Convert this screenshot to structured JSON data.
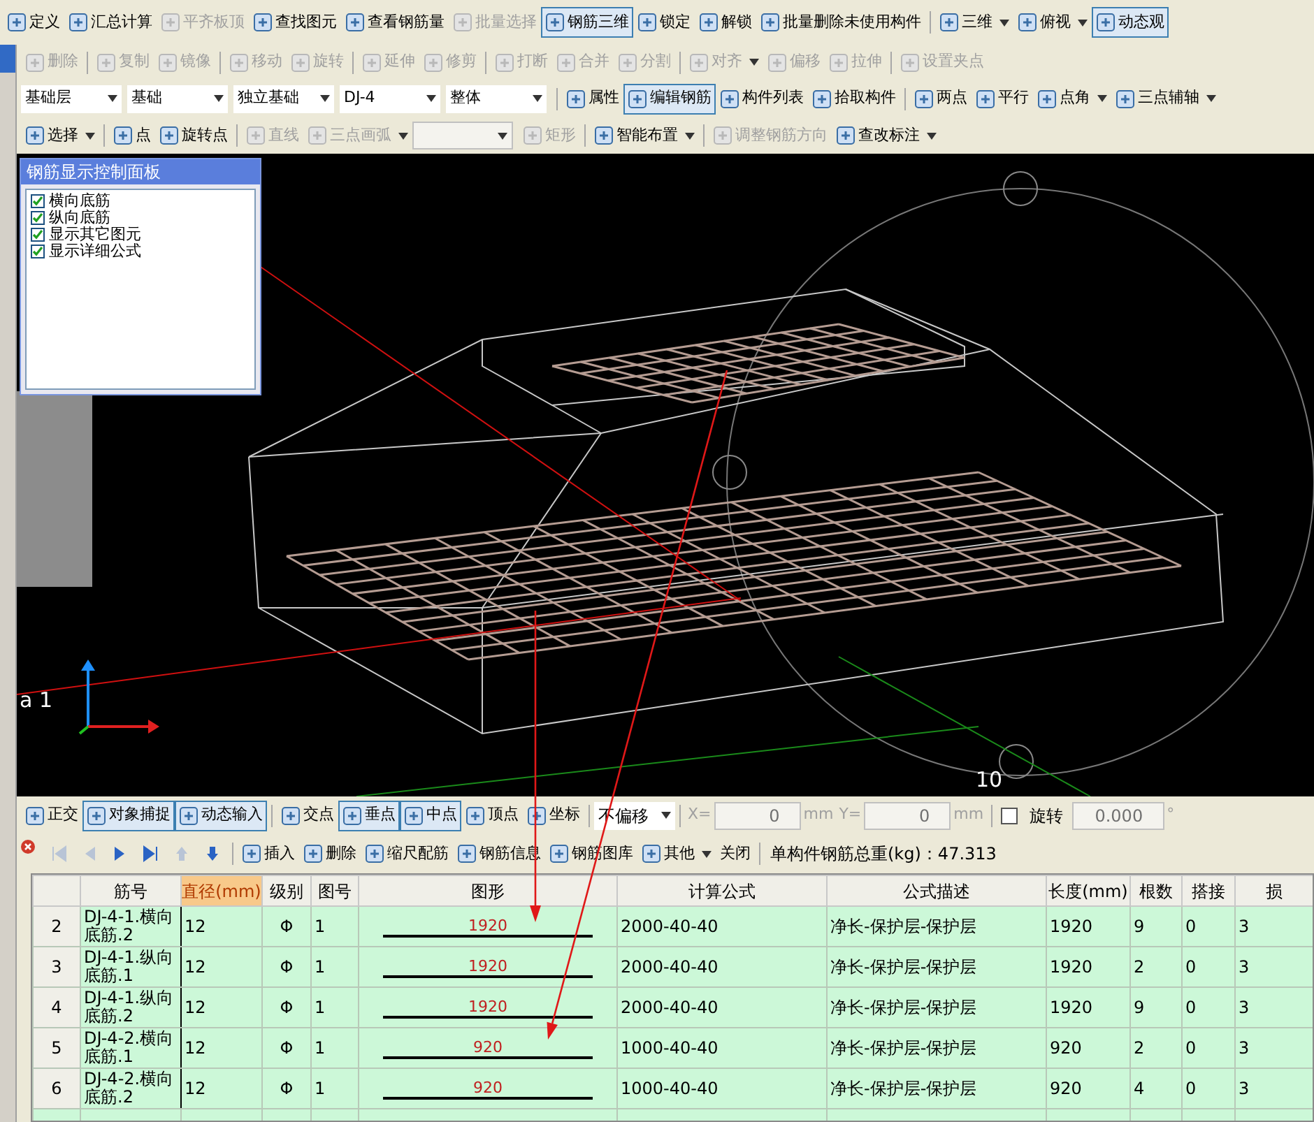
{
  "toolbar_main": [
    {
      "label": "定义",
      "pressed": false,
      "disabled": false,
      "dropdown": false,
      "sep_before": false
    },
    {
      "label": "汇总计算",
      "pressed": false,
      "disabled": false,
      "dropdown": false,
      "sep_before": false
    },
    {
      "label": "平齐板顶",
      "pressed": false,
      "disabled": true,
      "dropdown": false,
      "sep_before": false
    },
    {
      "label": "查找图元",
      "pressed": false,
      "disabled": false,
      "dropdown": false,
      "sep_before": false
    },
    {
      "label": "查看钢筋量",
      "pressed": false,
      "disabled": false,
      "dropdown": false,
      "sep_before": false
    },
    {
      "label": "批量选择",
      "pressed": false,
      "disabled": true,
      "dropdown": false,
      "sep_before": false
    },
    {
      "label": "钢筋三维",
      "pressed": true,
      "disabled": false,
      "dropdown": false,
      "sep_before": false
    },
    {
      "label": "锁定",
      "pressed": false,
      "disabled": false,
      "dropdown": false,
      "sep_before": false
    },
    {
      "label": "解锁",
      "pressed": false,
      "disabled": false,
      "dropdown": false,
      "sep_before": false
    },
    {
      "label": "批量删除未使用构件",
      "pressed": false,
      "disabled": false,
      "dropdown": false,
      "sep_before": false
    },
    {
      "label": "三维",
      "pressed": false,
      "disabled": false,
      "dropdown": true,
      "sep_before": true
    },
    {
      "label": "俯视",
      "pressed": false,
      "disabled": false,
      "dropdown": true,
      "sep_before": false
    },
    {
      "label": "动态观",
      "pressed": true,
      "disabled": false,
      "dropdown": false,
      "sep_before": false
    }
  ],
  "toolbar_edit": [
    {
      "label": "删除",
      "pressed": false,
      "disabled": true,
      "dropdown": false,
      "sep_before": false
    },
    {
      "label": "复制",
      "pressed": false,
      "disabled": true,
      "dropdown": false,
      "sep_before": true
    },
    {
      "label": "镜像",
      "pressed": false,
      "disabled": true,
      "dropdown": false,
      "sep_before": false
    },
    {
      "label": "移动",
      "pressed": false,
      "disabled": true,
      "dropdown": false,
      "sep_before": true
    },
    {
      "label": "旋转",
      "pressed": false,
      "disabled": true,
      "dropdown": false,
      "sep_before": false
    },
    {
      "label": "延伸",
      "pressed": false,
      "disabled": true,
      "dropdown": false,
      "sep_before": true
    },
    {
      "label": "修剪",
      "pressed": false,
      "disabled": true,
      "dropdown": false,
      "sep_before": false
    },
    {
      "label": "打断",
      "pressed": false,
      "disabled": true,
      "dropdown": false,
      "sep_before": true
    },
    {
      "label": "合并",
      "pressed": false,
      "disabled": true,
      "dropdown": false,
      "sep_before": false
    },
    {
      "label": "分割",
      "pressed": false,
      "disabled": true,
      "dropdown": false,
      "sep_before": false
    },
    {
      "label": "对齐",
      "pressed": false,
      "disabled": true,
      "dropdown": true,
      "sep_before": true
    },
    {
      "label": "偏移",
      "pressed": false,
      "disabled": true,
      "dropdown": false,
      "sep_before": false
    },
    {
      "label": "拉伸",
      "pressed": false,
      "disabled": true,
      "dropdown": false,
      "sep_before": false
    },
    {
      "label": "设置夹点",
      "pressed": false,
      "disabled": true,
      "dropdown": false,
      "sep_before": true
    }
  ],
  "toolbar_component": [
    {
      "kind": "select",
      "value": "基础层"
    },
    {
      "kind": "select",
      "value": "基础"
    },
    {
      "kind": "select",
      "value": "独立基础"
    },
    {
      "kind": "select",
      "value": "DJ-4"
    },
    {
      "kind": "select",
      "value": "整体"
    },
    {
      "kind": "button",
      "label": "属性",
      "pressed": false,
      "disabled": false,
      "dropdown": false,
      "sep_before": true
    },
    {
      "kind": "button",
      "label": "编辑钢筋",
      "pressed": true,
      "disabled": false,
      "dropdown": false,
      "sep_before": false
    },
    {
      "kind": "button",
      "label": "构件列表",
      "pressed": false,
      "disabled": false,
      "dropdown": false,
      "sep_before": false
    },
    {
      "kind": "button",
      "label": "拾取构件",
      "pressed": false,
      "disabled": false,
      "dropdown": false,
      "sep_before": false
    },
    {
      "kind": "button",
      "label": "两点",
      "pressed": false,
      "disabled": false,
      "dropdown": false,
      "sep_before": true
    },
    {
      "kind": "button",
      "label": "平行",
      "pressed": false,
      "disabled": false,
      "dropdown": false,
      "sep_before": false
    },
    {
      "kind": "button",
      "label": "点角",
      "pressed": false,
      "disabled": false,
      "dropdown": true,
      "sep_before": false
    },
    {
      "kind": "button",
      "label": "三点辅轴",
      "pressed": false,
      "disabled": false,
      "dropdown": true,
      "sep_before": false
    }
  ],
  "toolbar_draw": [
    {
      "kind": "button",
      "label": "选择",
      "pressed": false,
      "disabled": false,
      "dropdown": true,
      "sep_before": false
    },
    {
      "kind": "button",
      "label": "点",
      "pressed": false,
      "disabled": false,
      "dropdown": false,
      "sep_before": true
    },
    {
      "kind": "button",
      "label": "旋转点",
      "pressed": false,
      "disabled": false,
      "dropdown": false,
      "sep_before": false
    },
    {
      "kind": "button",
      "label": "直线",
      "pressed": false,
      "disabled": true,
      "dropdown": false,
      "sep_before": true
    },
    {
      "kind": "button",
      "label": "三点画弧",
      "pressed": false,
      "disabled": true,
      "dropdown": true,
      "sep_before": false
    },
    {
      "kind": "select",
      "disabled": true
    },
    {
      "kind": "button",
      "label": "矩形",
      "pressed": false,
      "disabled": true,
      "dropdown": false,
      "sep_before": false
    },
    {
      "kind": "button",
      "label": "智能布置",
      "pressed": false,
      "disabled": false,
      "dropdown": true,
      "sep_before": true
    },
    {
      "kind": "button",
      "label": "调整钢筋方向",
      "pressed": false,
      "disabled": true,
      "dropdown": false,
      "sep_before": true
    },
    {
      "kind": "button",
      "label": "查改标注",
      "pressed": false,
      "disabled": false,
      "dropdown": true,
      "sep_before": false
    }
  ],
  "viewport": {
    "panel": {
      "title": "钢筋显示控制面板",
      "options": [
        {
          "label": "横向底筋",
          "checked": true
        },
        {
          "label": "纵向底筋",
          "checked": true
        },
        {
          "label": "显示其它图元",
          "checked": true
        },
        {
          "label": "显示详细公式",
          "checked": true
        }
      ]
    },
    "axis_label": "a 1",
    "circle_label": "10"
  },
  "snap_toolbar": {
    "items": [
      {
        "label": "正交",
        "pressed": false,
        "sep_before": false
      },
      {
        "label": "对象捕捉",
        "pressed": true,
        "sep_before": false
      },
      {
        "label": "动态输入",
        "pressed": true,
        "sep_before": false
      },
      {
        "label": "交点",
        "pressed": false,
        "sep_before": true
      },
      {
        "label": "垂点",
        "pressed": true,
        "sep_before": false
      },
      {
        "label": "中点",
        "pressed": true,
        "sep_before": false
      },
      {
        "label": "顶点",
        "pressed": false,
        "sep_before": false
      },
      {
        "label": "坐标",
        "pressed": false,
        "sep_before": false
      }
    ],
    "offset": "不偏移",
    "x_label": "X=",
    "x_value": "0",
    "x_unit": "mm",
    "y_label": "Y=",
    "y_value": "0",
    "y_unit": "mm",
    "rotate": {
      "label": "旋转",
      "checked": false,
      "value": "0.000",
      "unit": "°"
    }
  },
  "rebar_toolbar": {
    "nav": [
      {
        "kind": "first",
        "disabled": true
      },
      {
        "kind": "prev",
        "disabled": true
      },
      {
        "kind": "next",
        "disabled": false
      },
      {
        "kind": "last",
        "disabled": false
      },
      {
        "kind": "up",
        "disabled": true
      },
      {
        "kind": "down",
        "disabled": false
      }
    ],
    "items": [
      {
        "label": "插入",
        "icon": true,
        "dropdown": false,
        "sep_before": true
      },
      {
        "label": "删除",
        "icon": true,
        "dropdown": false,
        "sep_before": false
      },
      {
        "label": "缩尺配筋",
        "icon": true,
        "dropdown": false,
        "sep_before": false
      },
      {
        "label": "钢筋信息",
        "icon": true,
        "dropdown": false,
        "sep_before": false
      },
      {
        "label": "钢筋图库",
        "icon": true,
        "dropdown": false,
        "sep_before": false
      },
      {
        "label": "其他",
        "icon": true,
        "dropdown": true,
        "sep_before": false
      },
      {
        "label": "关闭",
        "icon": false,
        "dropdown": false,
        "sep_before": false
      }
    ],
    "total": "单构件钢筋总重(kg)：47.313"
  },
  "table": {
    "columns": [
      {
        "selected": false
      },
      {
        "label": "筋号",
        "selected": false
      },
      {
        "label": "直径(mm)",
        "selected": true
      },
      {
        "label": "级别",
        "selected": false
      },
      {
        "label": "图号",
        "selected": false
      },
      {
        "label": "图形",
        "selected": false
      },
      {
        "label": "计算公式",
        "selected": false
      },
      {
        "label": "公式描述",
        "selected": false
      },
      {
        "label": "长度(mm)",
        "selected": false
      },
      {
        "label": "根数",
        "selected": false
      },
      {
        "label": "搭接",
        "selected": false
      },
      {
        "label": "损",
        "selected": false
      }
    ],
    "rows": [
      {
        "index": "2",
        "name": "DJ-4-1.横向底筋.2",
        "diameter": "12",
        "grade": "Φ",
        "figure_no": "1",
        "shape_length": "1920",
        "formula": "2000-40-40",
        "description": "净长-保护层-保护层",
        "length": "1920",
        "count": "9",
        "lap": "0",
        "loss": "3"
      },
      {
        "index": "3",
        "name": "DJ-4-1.纵向底筋.1",
        "diameter": "12",
        "grade": "Φ",
        "figure_no": "1",
        "shape_length": "1920",
        "formula": "2000-40-40",
        "description": "净长-保护层-保护层",
        "length": "1920",
        "count": "2",
        "lap": "0",
        "loss": "3"
      },
      {
        "index": "4",
        "name": "DJ-4-1.纵向底筋.2",
        "diameter": "12",
        "grade": "Φ",
        "figure_no": "1",
        "shape_length": "1920",
        "formula": "2000-40-40",
        "description": "净长-保护层-保护层",
        "length": "1920",
        "count": "9",
        "lap": "0",
        "loss": "3"
      },
      {
        "index": "5",
        "name": "DJ-4-2.横向底筋.1",
        "diameter": "12",
        "grade": "Φ",
        "figure_no": "1",
        "shape_length": "920",
        "formula": "1000-40-40",
        "description": "净长-保护层-保护层",
        "length": "920",
        "count": "2",
        "lap": "0",
        "loss": "3"
      },
      {
        "index": "6",
        "name": "DJ-4-2.横向底筋.2",
        "diameter": "12",
        "grade": "Φ",
        "figure_no": "1",
        "shape_length": "920",
        "formula": "1000-40-40",
        "description": "净长-保护层-保护层",
        "length": "920",
        "count": "4",
        "lap": "0",
        "loss": "3"
      }
    ]
  }
}
